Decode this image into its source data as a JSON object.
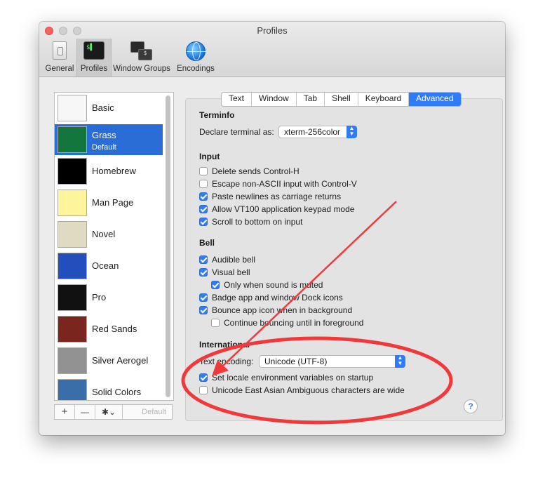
{
  "window": {
    "title": "Profiles"
  },
  "toolbar": {
    "items": [
      {
        "label": "General",
        "icon": "general-switch-icon"
      },
      {
        "label": "Profiles",
        "icon": "terminal-icon",
        "prompt": "$▌"
      },
      {
        "label": "Window Groups",
        "icon": "window-groups-icon",
        "prompt": "$"
      },
      {
        "label": "Encodings",
        "icon": "globe-icon"
      }
    ],
    "selected": "Profiles"
  },
  "profiles": [
    {
      "name": "Basic",
      "thumb_color": "#f7f7f7"
    },
    {
      "name": "Grass",
      "subtitle": "Default",
      "thumb_color": "#13773d"
    },
    {
      "name": "Homebrew",
      "thumb_color": "#000000"
    },
    {
      "name": "Man Page",
      "thumb_color": "#fef49c"
    },
    {
      "name": "Novel",
      "thumb_color": "#dfdbc3"
    },
    {
      "name": "Ocean",
      "thumb_color": "#224fbc"
    },
    {
      "name": "Pro",
      "thumb_color": "#111111"
    },
    {
      "name": "Red Sands",
      "thumb_color": "#7a251e"
    },
    {
      "name": "Silver Aerogel",
      "thumb_color": "#929292"
    },
    {
      "name": "Solid Colors",
      "thumb_color": "#3a6ea8"
    }
  ],
  "profile_toolbar": {
    "add": "+",
    "remove": "—",
    "gear": "✱",
    "chevron": "⌄",
    "default_label": "Default"
  },
  "tabs": [
    "Text",
    "Window",
    "Tab",
    "Shell",
    "Keyboard",
    "Advanced"
  ],
  "active_tab": "Advanced",
  "terminfo": {
    "title": "Terminfo",
    "declare_label": "Declare terminal as:",
    "declare_value": "xterm-256color"
  },
  "input": {
    "title": "Input",
    "options": [
      {
        "label": "Delete sends Control-H",
        "checked": false
      },
      {
        "label": "Escape non-ASCII input with Control-V",
        "checked": false
      },
      {
        "label": "Paste newlines as carriage returns",
        "checked": true
      },
      {
        "label": "Allow VT100 application keypad mode",
        "checked": true
      },
      {
        "label": "Scroll to bottom on input",
        "checked": true
      }
    ]
  },
  "bell": {
    "title": "Bell",
    "options": [
      {
        "label": "Audible bell",
        "checked": true,
        "indent": 0
      },
      {
        "label": "Visual bell",
        "checked": true,
        "indent": 0
      },
      {
        "label": "Only when sound is muted",
        "checked": true,
        "indent": 1
      },
      {
        "label": "Badge app and window Dock icons",
        "checked": true,
        "indent": 0
      },
      {
        "label": "Bounce app icon when in background",
        "checked": true,
        "indent": 0
      },
      {
        "label": "Continue bouncing until in foreground",
        "checked": false,
        "indent": 1
      }
    ]
  },
  "international": {
    "title": "International",
    "encoding_label": "Text encoding:",
    "encoding_value": "Unicode (UTF-8)",
    "options": [
      {
        "label": "Set locale environment variables on startup",
        "checked": true
      },
      {
        "label": "Unicode East Asian Ambiguous characters are wide",
        "checked": false
      }
    ]
  },
  "help": "?",
  "annotation": {
    "color": "#f0393a"
  }
}
